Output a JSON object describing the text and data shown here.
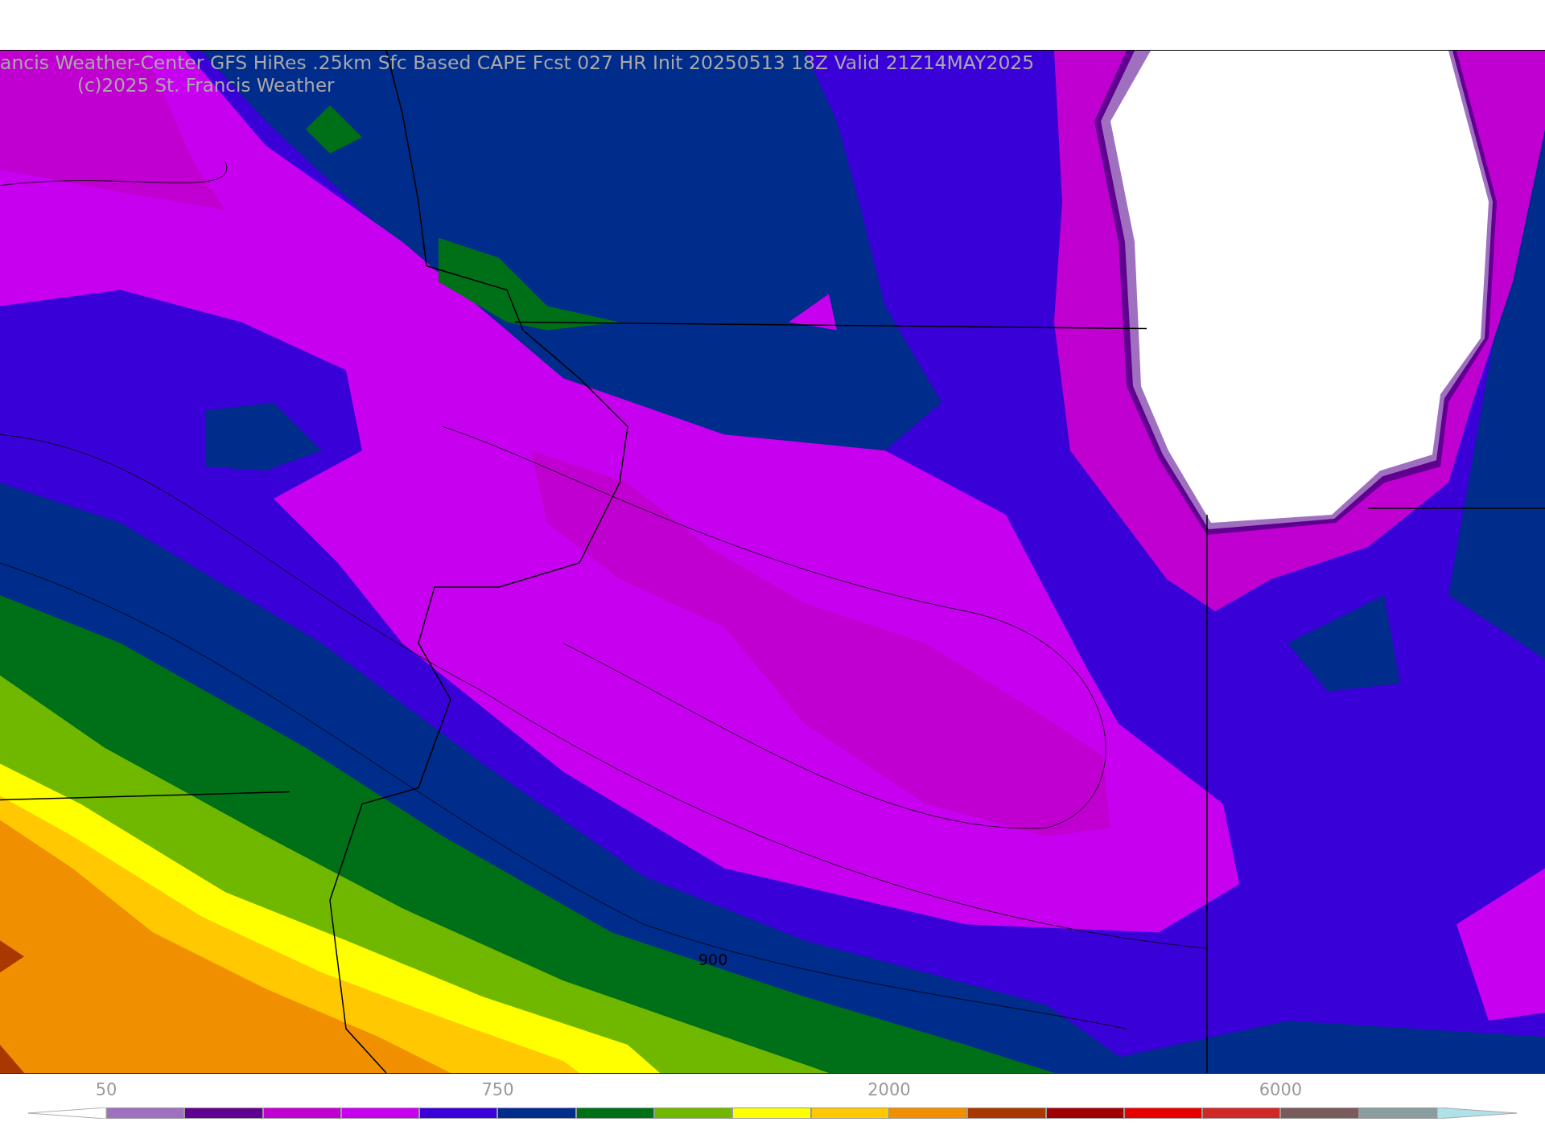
{
  "title": "ancis Weather-Center GFS HiRes .25km Sfc Based CAPE  Fcst 027 HR Init 20250513 18Z  Valid 21Z14MAY2025",
  "copyright": "(c)2025 St. Francis Weather",
  "contour_label": "900",
  "colorbar": {
    "bins": [
      {
        "color": "#a070c0"
      },
      {
        "color": "#600090"
      },
      {
        "color": "#c000d0"
      },
      {
        "color": "#c800f0"
      },
      {
        "color": "#3a00d8"
      },
      {
        "color": "#002c8c"
      },
      {
        "color": "#007018"
      },
      {
        "color": "#70b800"
      },
      {
        "color": "#ffff00"
      },
      {
        "color": "#ffc800"
      },
      {
        "color": "#f09000"
      },
      {
        "color": "#a83800"
      },
      {
        "color": "#a00000"
      },
      {
        "color": "#e80000"
      },
      {
        "color": "#d02828"
      },
      {
        "color": "#7a5a5a"
      },
      {
        "color": "#8a9ea0"
      }
    ],
    "ticks": [
      {
        "label": "50"
      },
      {
        "label": "750"
      },
      {
        "label": "2000"
      },
      {
        "label": "6000"
      }
    ]
  }
}
